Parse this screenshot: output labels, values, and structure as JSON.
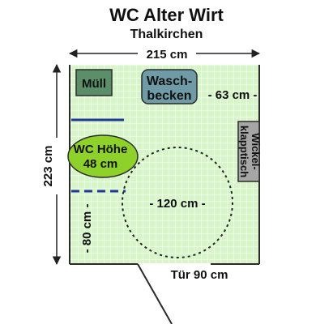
{
  "title": "WC Alter Wirt",
  "subtitle": "Thalkirchen",
  "dimensions": {
    "width": "215 cm",
    "depth": "223 cm",
    "sink_clearance": "- 63 cm -",
    "turning_circle": "- 120 cm -",
    "side_space": "- 80 cm -",
    "door": "Tür 90 cm"
  },
  "fixtures": {
    "trash": "Müll",
    "sink_line1": "Wasch-",
    "sink_line2": "becken",
    "changing_line1": "Wickel-",
    "changing_line2": "klapptisch",
    "toilet_line1": "WC Höhe",
    "toilet_line2": "48 cm"
  },
  "colors": {
    "floor": "#d7f5c9",
    "grid": "#ffffff",
    "wall": "#2b2b2b",
    "trash": "#5a8f69",
    "sink": "#6f9ba6",
    "changing_table": "#a6a6a6",
    "toilet": "#8fd12b",
    "grab_bar": "#1f3a93"
  }
}
